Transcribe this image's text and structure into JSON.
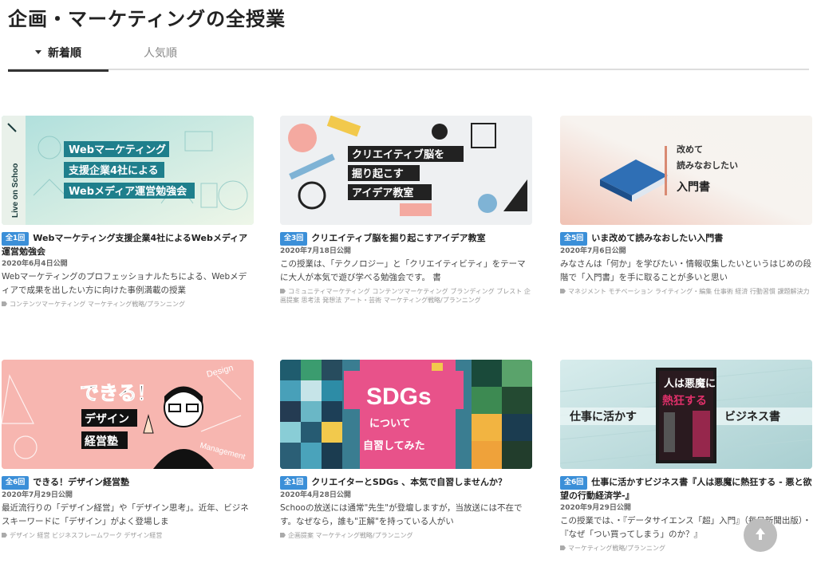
{
  "page": {
    "title": "企画・マーケティングの全授業"
  },
  "tabs": [
    {
      "label": "新着順",
      "active": true
    },
    {
      "label": "人気順",
      "active": false
    }
  ],
  "cards": [
    {
      "badge": "全1回",
      "title": "Webマーケティング支援企業4社によるWebメディア運営勉強会",
      "date": "2020年6月4日公開",
      "desc": "Webマーケティングのプロフェッショナルたちによる、Webメディアで成果を出したい方に向けた事例満載の授業",
      "tags": "コンテンツマーケティング マーケティング戦略/プランニング",
      "thumb": {
        "lines": [
          "Webマーケティング",
          "支援企業4社による",
          "Webメディア運営勉強会"
        ],
        "side": "Live on Schoo",
        "colors": [
          "#bfe3e0",
          "#1f7f8c",
          "#e8f4f2"
        ]
      }
    },
    {
      "badge": "全3回",
      "title": "クリエイティブ脳を掘り起こすアイデア教室",
      "date": "2020年7月18日公開",
      "desc": "この授業は、「テクノロジー」と「クリエイティビティ」をテーマに大人が本気で遊び学べる勉強会です。 書",
      "tags": "コミュニティマーケティング コンテンツマーケティング ブランディング ブレスト 企画提案 思考法 発想法 アート・芸術 マーケティング戦略/プランニング",
      "thumb": {
        "lines": [
          "クリエイティブ脳を",
          "掘り起こす",
          "アイデア教室"
        ],
        "colors": [
          "#eef0f2",
          "#222222",
          "#f4a9a0"
        ]
      }
    },
    {
      "badge": "全5回",
      "title": "いま改めて読みなおしたい入門書",
      "date": "2020年7月6日公開",
      "desc": "みなさんは「何か」を学びたい・情報収集したいというはじめの段階で「入門書」を手に取ることが多いと思い",
      "tags": "マネジメント モチベーション ライティング・編集 仕事術 経済 行動習慣 課題解決力",
      "thumb": {
        "lines": [
          "改めて",
          "読みなおしたい",
          "入門書"
        ],
        "colors": [
          "#f6f3ef",
          "#2f6fb5",
          "#d98a73"
        ]
      }
    },
    {
      "badge": "全6回",
      "title": "できる！デザイン経営塾",
      "date": "2020年7月29日公開",
      "desc": "最近流行りの「デザイン経営」や「デザイン思考」。近年、ビジネスキーワードに「デザイン」がよく登場しま",
      "tags": "デザイン 経営 ビジネスフレームワーク デザイン経営",
      "thumb": {
        "lines": [
          "できる！",
          "デザイン",
          "経営塾"
        ],
        "words": [
          "Design",
          "Management"
        ],
        "colors": [
          "#f7b6b0",
          "#111111",
          "#ffffff"
        ]
      }
    },
    {
      "badge": "全1回",
      "title": "クリエイターとSDGs 、本気で自習しませんか？",
      "date": "2020年4月28日公開",
      "desc": "Schooの放送には通常\"先生\"が登壇しますが，当放送には不在です。なぜなら，誰も\"正解\"を持っている人がい",
      "tags": "企画提案 マーケティング戦略/プランニング",
      "thumb": {
        "lines": [
          "SDGs",
          "について",
          "自習してみた"
        ],
        "colors": [
          "#e8528a",
          "#2c6e8f",
          "#f2c94c"
        ]
      }
    },
    {
      "badge": "全6回",
      "title": "仕事に活かすビジネス書『人は悪魔に熱狂する - 悪と欲望の行動経済学-』",
      "date": "2020年9月29日公開",
      "desc": "この授業では、・『データサイエンス「超」入門』（毎日新聞出版）・『なぜ「つい買ってしまう」のか？』",
      "tags": "マーケティング戦略/プランニング",
      "thumb": {
        "lines": [
          "仕事に活かす",
          "ビジネス書"
        ],
        "book": [
          "人は悪魔に",
          "熱狂する"
        ],
        "colors": [
          "#c9e3e4",
          "#1a1a1a",
          "#e0306a"
        ]
      }
    }
  ],
  "icons": {
    "scroll_top": "arrow-up-icon",
    "tag": "tag-icon",
    "sort": "caret-down-icon"
  }
}
